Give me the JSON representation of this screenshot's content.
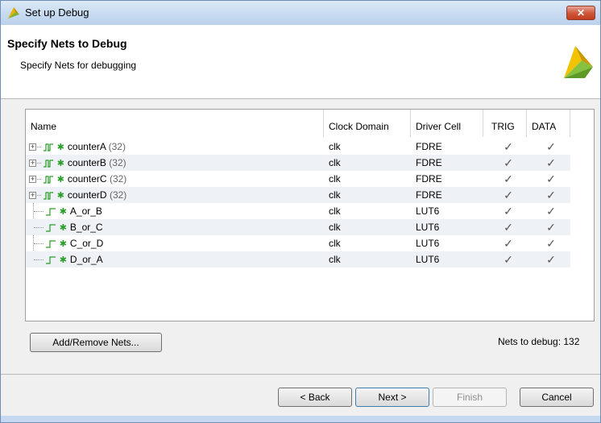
{
  "window": {
    "title": "Set up Debug",
    "close_label": "✕"
  },
  "header": {
    "title": "Specify Nets to Debug",
    "subtitle": "Specify Nets for debugging"
  },
  "table": {
    "columns": [
      "Name",
      "Clock Domain",
      "Driver Cell",
      "TRIG",
      "DATA"
    ],
    "rows": [
      {
        "name": "counterA",
        "count": "(32)",
        "clock": "clk",
        "driver": "FDRE",
        "trig": "✓",
        "data": "✓"
      },
      {
        "name": "counterB",
        "count": "(32)",
        "clock": "clk",
        "driver": "FDRE",
        "trig": "✓",
        "data": "✓"
      },
      {
        "name": "counterC",
        "count": "(32)",
        "clock": "clk",
        "driver": "FDRE",
        "trig": "✓",
        "data": "✓"
      },
      {
        "name": "counterD",
        "count": "(32)",
        "clock": "clk",
        "driver": "FDRE",
        "trig": "✓",
        "data": "✓"
      },
      {
        "name": "A_or_B",
        "clock": "clk",
        "driver": "LUT6",
        "trig": "✓",
        "data": "✓"
      },
      {
        "name": "B_or_C",
        "clock": "clk",
        "driver": "LUT6",
        "trig": "✓",
        "data": "✓"
      },
      {
        "name": "C_or_D",
        "clock": "clk",
        "driver": "LUT6",
        "trig": "✓",
        "data": "✓"
      },
      {
        "name": "D_or_A",
        "clock": "clk",
        "driver": "LUT6",
        "trig": "✓",
        "data": "✓"
      }
    ]
  },
  "actions": {
    "add_remove": "Add/Remove Nets...",
    "nets_status": "Nets to debug: 132"
  },
  "footer": {
    "back": "< Back",
    "next": "Next >",
    "finish": "Finish",
    "cancel": "Cancel"
  },
  "colors": {
    "bug": "#2a9d2a",
    "bus_icon": "#2a9d2a",
    "row_alt": "#eef1f5"
  }
}
